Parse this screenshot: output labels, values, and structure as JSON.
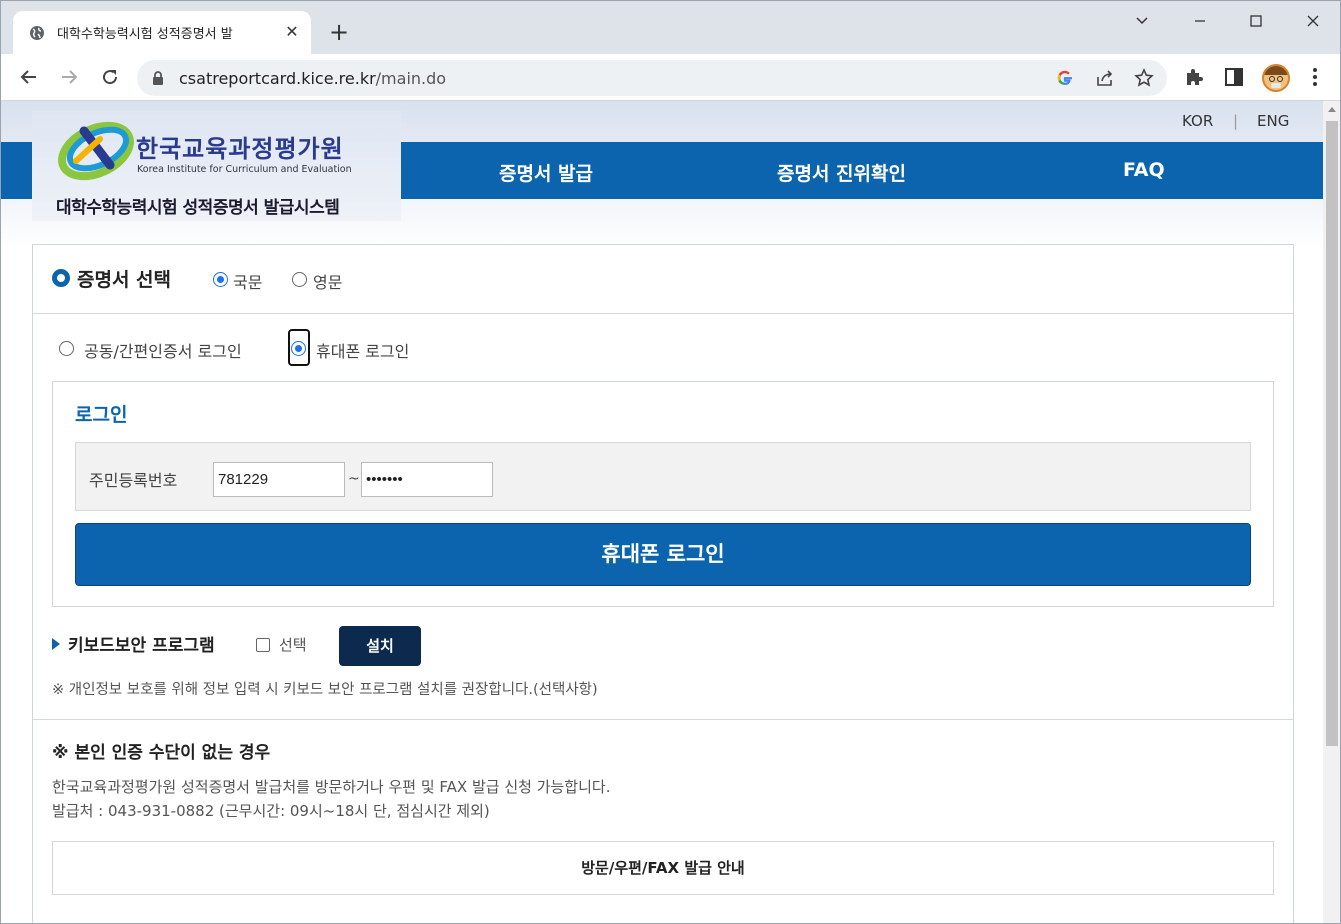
{
  "browser": {
    "tab_title": "대학수학능력시험 성적증명서 발",
    "tab_close": "✕",
    "new_tab": "+",
    "window_controls": {
      "minimize": "⌄",
      "restore": "—",
      "maximize": "☐",
      "close": "✕"
    },
    "url_host": "csatreportcard.kice.re.kr",
    "url_path": "/main.do",
    "icons": [
      "back-icon",
      "forward-icon",
      "reload-icon",
      "lock-icon",
      "google-icon",
      "share-icon",
      "star-icon",
      "extensions-icon",
      "side-panel-icon",
      "avatar",
      "menu-icon"
    ]
  },
  "header": {
    "lang_kor": "KOR",
    "lang_sep": "|",
    "lang_eng": "ENG",
    "logo_kor": "한국교육과정평가원",
    "logo_eng": "Korea Institute for Curriculum and Evaluation",
    "logo_system": "대학수학능력시험 성적증명서 발급시스템",
    "menu": [
      "증명서 발급",
      "증명서 진위확인",
      "FAQ"
    ],
    "brand_color": "#0b64ad"
  },
  "certificate": {
    "title": "증명서 선택",
    "options": [
      {
        "label": "국문",
        "selected": true
      },
      {
        "label": "영문",
        "selected": false
      }
    ]
  },
  "login_method": {
    "options": [
      {
        "label": "공동/간편인증서 로그인",
        "selected": false
      },
      {
        "label": "휴대폰 로그인",
        "selected": true
      }
    ]
  },
  "login": {
    "title": "로그인",
    "id_label": "주민등록번호",
    "id_front": "781229",
    "id_sep": "~",
    "id_back": "•••••••",
    "button": "휴대폰 로그인"
  },
  "keyboard": {
    "title": "키보드보안 프로그램",
    "checkbox_label": "선택",
    "checked": false,
    "install_button": "설치",
    "note": "※ 개인정보 보호를 위해 정보 입력 시 키보드 보안 프로그램 설치를 권장합니다.(선택사항)"
  },
  "no_means": {
    "title": "※ 본인 인증 수단이 없는 경우",
    "line1": "한국교육과정평가원 성적증명서 발급처를 방문하거나 우편 및 FAX 발급 신청 가능합니다.",
    "line2": "발급처 : 043-931-0882 (근무시간: 09시~18시 단, 점심시간 제외)",
    "guide_button": "방문/우편/FAX 발급 안내"
  }
}
